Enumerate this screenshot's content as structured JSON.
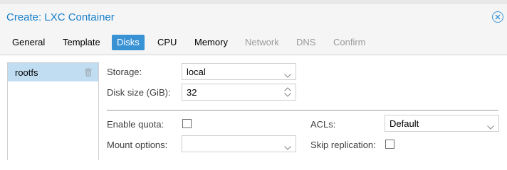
{
  "window": {
    "title": "Create: LXC Container",
    "close_icon": "close-circle-icon"
  },
  "tabs": [
    {
      "label": "General",
      "state": "enabled"
    },
    {
      "label": "Template",
      "state": "enabled"
    },
    {
      "label": "Disks",
      "state": "active"
    },
    {
      "label": "CPU",
      "state": "enabled"
    },
    {
      "label": "Memory",
      "state": "enabled"
    },
    {
      "label": "Network",
      "state": "disabled"
    },
    {
      "label": "DNS",
      "state": "disabled"
    },
    {
      "label": "Confirm",
      "state": "disabled"
    }
  ],
  "disk_list": {
    "items": [
      {
        "label": "rootfs",
        "selected": true,
        "delete_icon": "trash-icon"
      }
    ]
  },
  "form": {
    "storage": {
      "label": "Storage:",
      "value": "local"
    },
    "disk_size": {
      "label": "Disk size (GiB):",
      "value": "32"
    },
    "enable_quota": {
      "label": "Enable quota:",
      "checked": false
    },
    "acls": {
      "label": "ACLs:",
      "value": "Default"
    },
    "mount_options": {
      "label": "Mount options:",
      "value": ""
    },
    "skip_replication": {
      "label": "Skip replication:",
      "checked": false
    }
  },
  "colors": {
    "accent": "#3892d4",
    "title": "#157fcc",
    "selected_row": "#c1ddf1"
  }
}
